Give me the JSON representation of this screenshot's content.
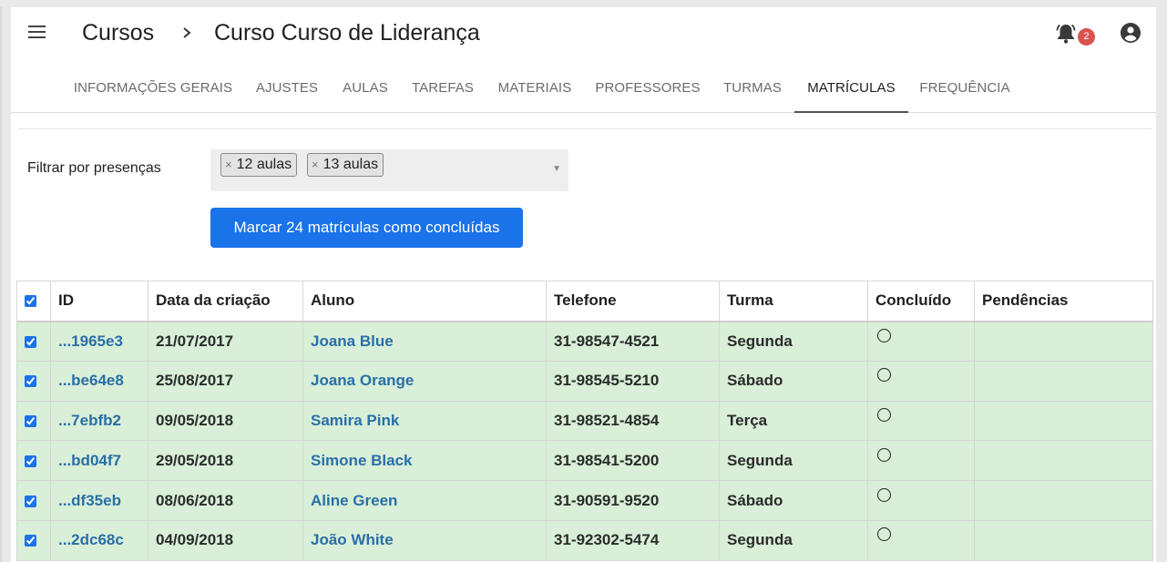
{
  "header": {
    "breadcrumb_root": "Cursos",
    "breadcrumb_current": "Curso Curso de Liderança",
    "notification_count": "2"
  },
  "tabs": [
    {
      "label": "INFORMAÇÕES GERAIS"
    },
    {
      "label": "AJUSTES"
    },
    {
      "label": "AULAS"
    },
    {
      "label": "TAREFAS"
    },
    {
      "label": "MATERIAIS"
    },
    {
      "label": "PROFESSORES"
    },
    {
      "label": "TURMAS"
    },
    {
      "label": "MATRÍCULAS",
      "active": true
    },
    {
      "label": "FREQUÊNCIA"
    }
  ],
  "filter": {
    "label": "Filtrar por presenças",
    "chips": [
      "12 aulas",
      "13 aulas"
    ],
    "remove_glyph": "×"
  },
  "action_button": "Marcar 24 matrículas como concluídas",
  "table": {
    "columns": [
      "ID",
      "Data da criação",
      "Aluno",
      "Telefone",
      "Turma",
      "Concluído",
      "Pendências"
    ],
    "rows": [
      {
        "id": "...1965e3",
        "date": "21/07/2017",
        "student": "Joana Blue",
        "phone": "31-98547-4521",
        "class": "Segunda"
      },
      {
        "id": "...be64e8",
        "date": "25/08/2017",
        "student": "Joana Orange",
        "phone": "31-98545-5210",
        "class": "Sábado"
      },
      {
        "id": "...7ebfb2",
        "date": "09/05/2018",
        "student": "Samira Pink",
        "phone": "31-98521-4854",
        "class": "Terça"
      },
      {
        "id": "...bd04f7",
        "date": "29/05/2018",
        "student": "Simone Black",
        "phone": "31-98541-5200",
        "class": "Segunda"
      },
      {
        "id": "...df35eb",
        "date": "08/06/2018",
        "student": "Aline Green",
        "phone": "31-90591-9520",
        "class": "Sábado"
      },
      {
        "id": "...2dc68c",
        "date": "04/09/2018",
        "student": "João White",
        "phone": "31-92302-5474",
        "class": "Segunda"
      }
    ]
  },
  "colors": {
    "primary": "#1a73e8",
    "row_highlight": "#d9efd8",
    "link": "#2a6fa8",
    "badge": "#d9534f"
  }
}
